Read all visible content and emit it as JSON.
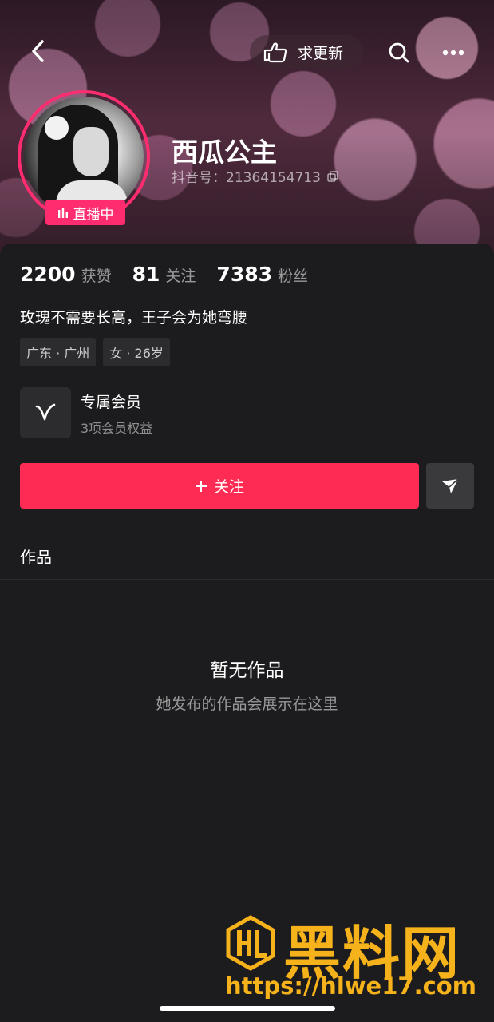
{
  "header": {
    "refresh_label": "求更新"
  },
  "profile": {
    "name": "西瓜公主",
    "douyin_id": "抖音号：21364154713",
    "live_label": "直播中"
  },
  "stats": [
    {
      "num": "2200",
      "label": "获赞"
    },
    {
      "num": "81",
      "label": "关注"
    },
    {
      "num": "7383",
      "label": "粉丝"
    }
  ],
  "bio": "玫瑰不需要长高，王子会为她弯腰",
  "tags": [
    "广东 · 广州",
    "女 · 26岁"
  ],
  "member": {
    "title": "专属会员",
    "subtitle": "3项会员权益"
  },
  "actions": {
    "follow_label": "关注"
  },
  "tabs": {
    "works": "作品"
  },
  "empty_state": {
    "title": "暂无作品",
    "subtitle": "她发布的作品会展示在这里"
  },
  "watermark": {
    "brand": "黑料网",
    "url": "https://hlwe17.com"
  },
  "colors": {
    "accent": "#fe2c55",
    "live": "#ff2d6f",
    "watermark": "#f6b21a"
  }
}
